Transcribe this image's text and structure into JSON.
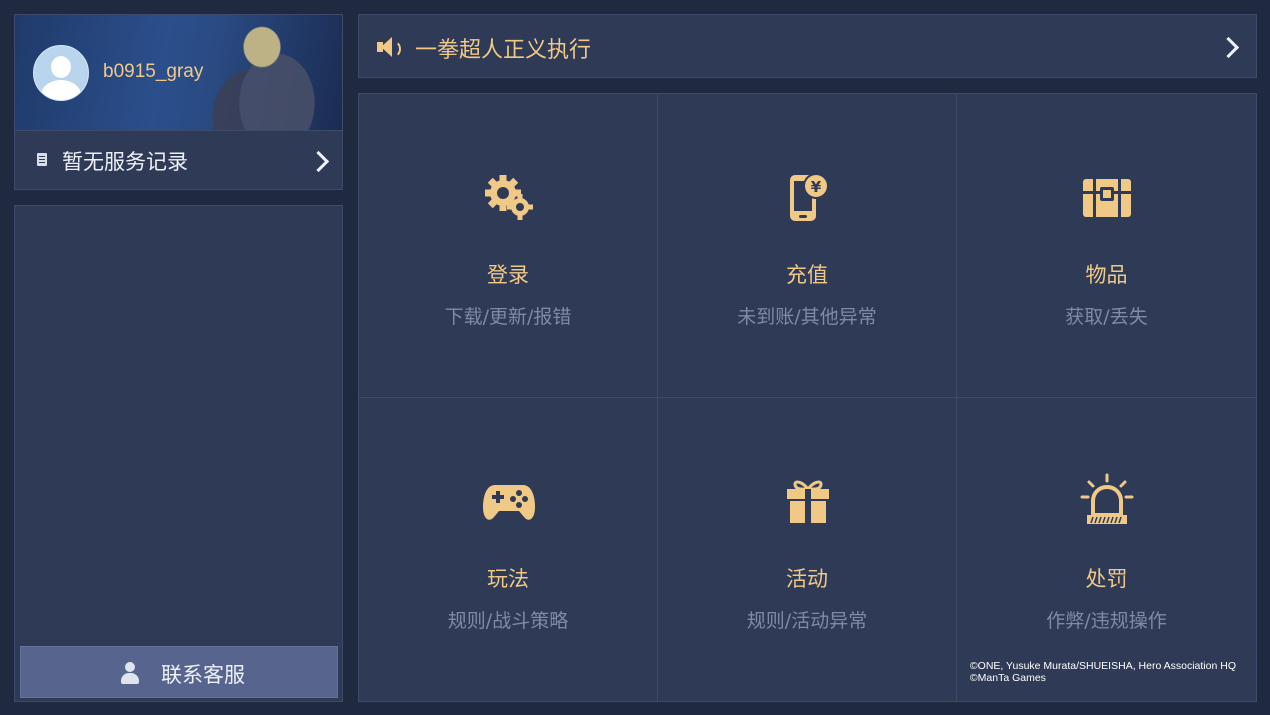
{
  "user": {
    "username": "b0915_gray"
  },
  "service": {
    "label": "暂无服务记录"
  },
  "contact": {
    "label": "联系客服"
  },
  "notice": {
    "text": "一拳超人正义执行"
  },
  "categories": [
    {
      "title": "登录",
      "subtitle": "下载/更新/报错",
      "icon": "gears-icon"
    },
    {
      "title": "充值",
      "subtitle": "未到账/其他异常",
      "icon": "phone-payment-icon"
    },
    {
      "title": "物品",
      "subtitle": "获取/丢失",
      "icon": "treasure-chest-icon"
    },
    {
      "title": "玩法",
      "subtitle": "规则/战斗策略",
      "icon": "gamepad-icon"
    },
    {
      "title": "活动",
      "subtitle": "规则/活动异常",
      "icon": "gift-icon"
    },
    {
      "title": "处罚",
      "subtitle": "作弊/违规操作",
      "icon": "alarm-icon"
    }
  ],
  "copyright": {
    "line1": "©ONE, Yusuke Murata/SHUEISHA, Hero Association HQ",
    "line2": "©ManTa Games"
  },
  "colors": {
    "accent": "#f0c987",
    "panel": "#2e3a56",
    "background": "#1f2a40"
  }
}
